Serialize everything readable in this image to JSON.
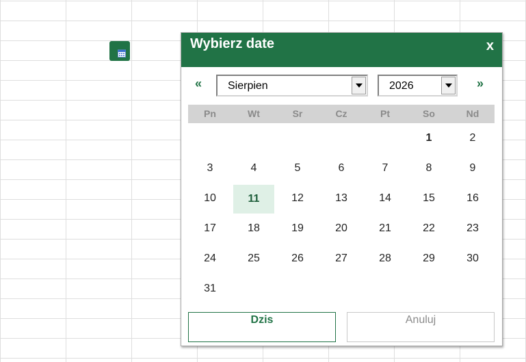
{
  "dialog": {
    "title": "Wybierz date",
    "close_label": "x",
    "prev_label": "«",
    "next_label": "»",
    "month": "Sierpien",
    "year": "2026",
    "weekdays": [
      "Pn",
      "Wt",
      "Sr",
      "Cz",
      "Pt",
      "So",
      "Nd"
    ],
    "weeks": [
      [
        "",
        "",
        "",
        "",
        "",
        "1",
        "2"
      ],
      [
        "3",
        "4",
        "5",
        "6",
        "7",
        "8",
        "9"
      ],
      [
        "10",
        "11",
        "12",
        "13",
        "14",
        "15",
        "16"
      ],
      [
        "17",
        "18",
        "19",
        "20",
        "21",
        "22",
        "23"
      ],
      [
        "24",
        "25",
        "26",
        "27",
        "28",
        "29",
        "30"
      ],
      [
        "31",
        "",
        "",
        "",
        "",
        "",
        ""
      ]
    ],
    "today_label": "Dzis",
    "cancel_label": "Anuluj"
  },
  "colors": {
    "accent": "#217346",
    "today_bg": "#dff0e6"
  }
}
